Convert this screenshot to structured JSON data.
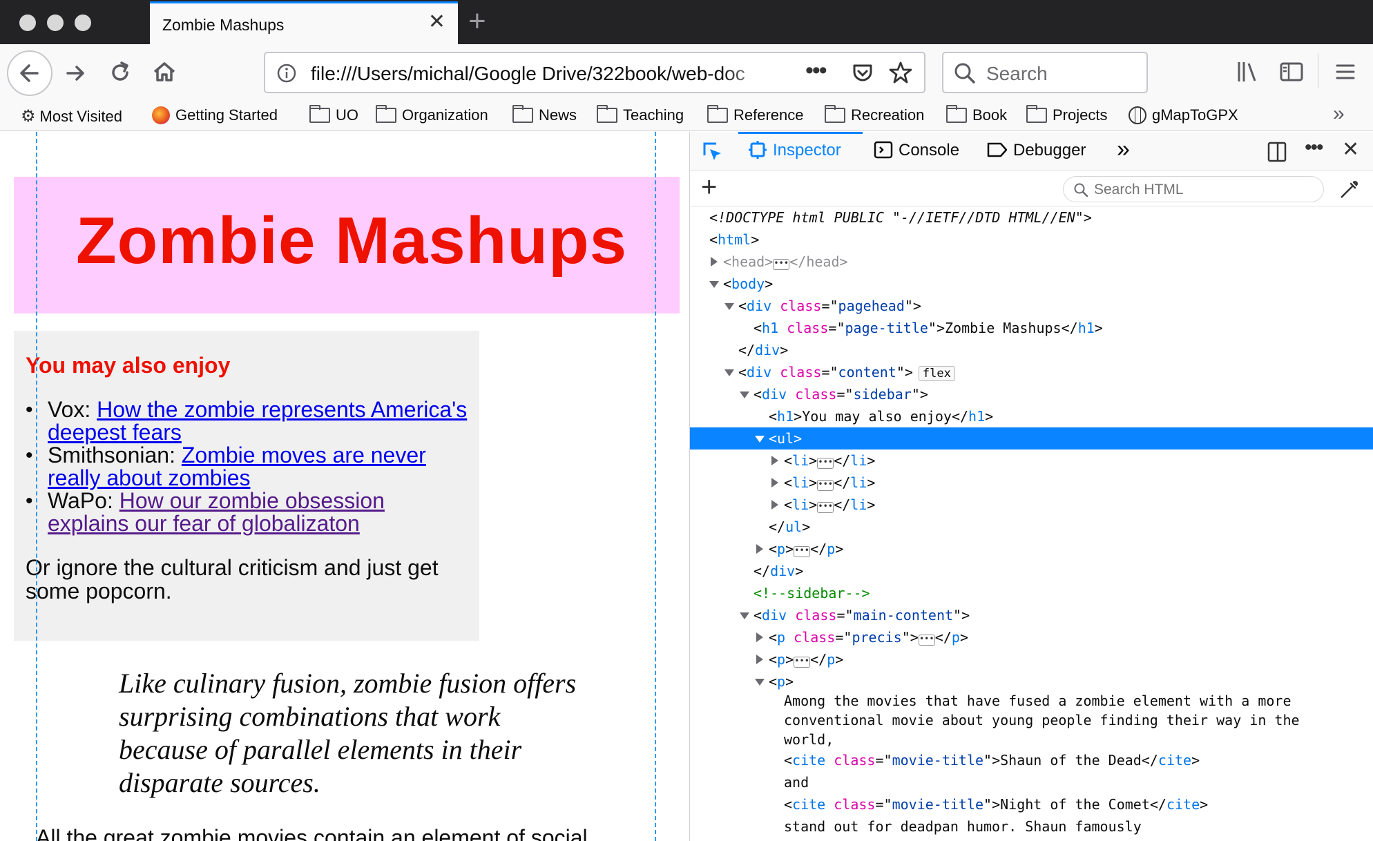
{
  "window": {
    "tab_title": "Zombie Mashups",
    "url": "file:///Users/michal/Google Drive/322book/web-doc",
    "search_placeholder": "Search"
  },
  "bookmarks": [
    {
      "label": "Most Visited",
      "icon": "gear-icon"
    },
    {
      "label": "Getting Started",
      "icon": "firefox-icon"
    },
    {
      "label": "UO",
      "icon": "folder-icon"
    },
    {
      "label": "Organization",
      "icon": "folder-icon"
    },
    {
      "label": "News",
      "icon": "folder-icon"
    },
    {
      "label": "Teaching",
      "icon": "folder-icon"
    },
    {
      "label": "Reference",
      "icon": "folder-icon"
    },
    {
      "label": "Recreation",
      "icon": "folder-icon"
    },
    {
      "label": "Book",
      "icon": "folder-icon"
    },
    {
      "label": "Projects",
      "icon": "folder-icon"
    },
    {
      "label": "gMapToGPX",
      "icon": "globe-icon"
    }
  ],
  "page": {
    "title": "Zombie Mashups",
    "sidebar_heading": "You may also enjoy",
    "links": [
      {
        "source": "Vox:",
        "text": "How the zombie represents America's deepest fears"
      },
      {
        "source": "Smithsonian:",
        "text": "Zombie moves are never really about zombies"
      },
      {
        "source": "WaPo:",
        "text": "How our zombie obsession explains our fear of globalizaton"
      }
    ],
    "sidebar_text": "Or ignore the cultural criticism and just get some popcorn.",
    "precis": "Like culinary fusion, zombie fusion offers surprising combinations that work because of parallel elements in their disparate sources.",
    "body_start": "All the great zombie movies contain an element of social"
  },
  "devtools": {
    "tabs": [
      "Inspector",
      "Console",
      "Debugger"
    ],
    "active_tab": "Inspector",
    "search_placeholder": "Search HTML",
    "doctype": "<!DOCTYPE html PUBLIC \"-//IETF//DTD HTML//EN\">",
    "flex_badge": "flex",
    "text_node": [
      "Among the movies that have fused a zombie element with a more",
      "conventional movie about young people finding their way in the",
      "world,"
    ],
    "cite1": "Shaun of the Dead",
    "and": "and",
    "cite2": "Night of the Comet",
    "text_tail": "stand out for deadpan humor. Shaun famously",
    "h1_title": "Zombie Mashups",
    "h1_sidebar": "You may also enjoy",
    "comment": "<!--sidebar-->"
  },
  "colors": {
    "accent": "#0a84ff",
    "page_title": "#ee1100",
    "pagehead_bg": "#ffccff",
    "sidebar_bg": "#f0f0f0"
  }
}
